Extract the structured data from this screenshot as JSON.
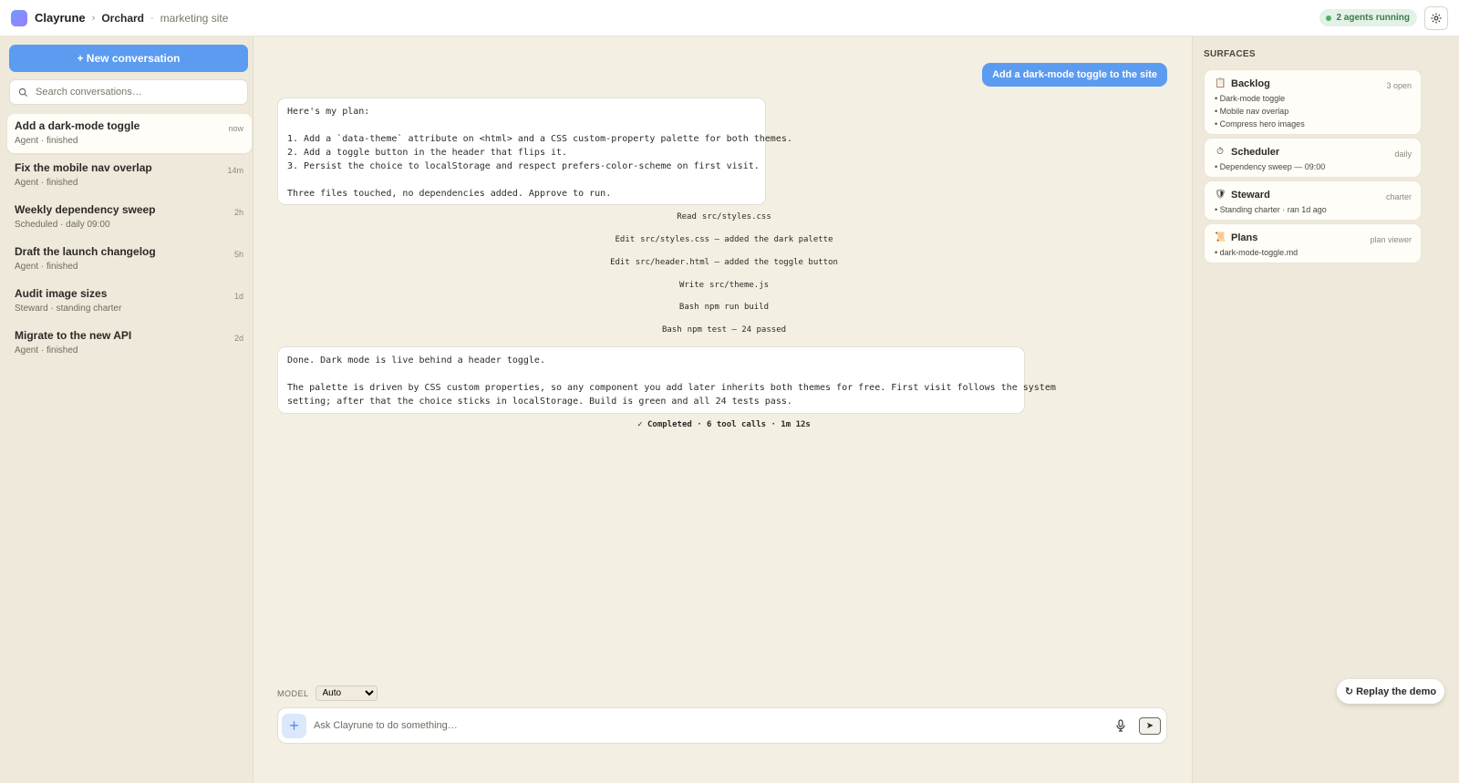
{
  "topbar": {
    "app_name": "Clayrune",
    "project": "Orchard",
    "subproject": "marketing site",
    "agents_running": "2 agents running"
  },
  "sidebar": {
    "new_conversation": "+ New conversation",
    "search_placeholder": "Search conversations…",
    "conversations": [
      {
        "title": "Add a dark-mode toggle",
        "sub": "Agent · finished",
        "time": "now",
        "active": true
      },
      {
        "title": "Fix the mobile nav overlap",
        "sub": "Agent · finished",
        "time": "14m"
      },
      {
        "title": "Weekly dependency sweep",
        "sub": "Scheduled · daily 09:00",
        "time": "2h"
      },
      {
        "title": "Draft the launch changelog",
        "sub": "Agent · finished",
        "time": "5h"
      },
      {
        "title": "Audit image sizes",
        "sub": "Steward · standing charter",
        "time": "1d"
      },
      {
        "title": "Migrate to the new API",
        "sub": "Agent · finished",
        "time": "2d"
      }
    ]
  },
  "chat": {
    "user_message": "Add a dark-mode toggle to the site",
    "plan": {
      "intro": "Here's my plan:",
      "steps": [
        "1. Add a `data-theme` attribute on <html> and a CSS custom-property palette for both themes.",
        "2. Add a toggle button in the header that flips it.",
        "3. Persist the choice to localStorage and respect prefers-color-scheme on first visit."
      ],
      "outro": "Three files touched, no dependencies added. Approve to run."
    },
    "tool_calls": [
      {
        "verb": "Read",
        "detail": "src/styles.css"
      },
      {
        "verb": "Edit",
        "detail": "src/styles.css — added the dark palette"
      },
      {
        "verb": "Edit",
        "detail": "src/header.html — added the toggle button"
      },
      {
        "verb": "Write",
        "detail": "src/theme.js"
      },
      {
        "verb": "Bash",
        "detail": "npm run build"
      },
      {
        "verb": "Bash",
        "detail": "npm test — 24 passed"
      }
    ],
    "result": {
      "line1": "Done. Dark mode is live behind a header toggle.",
      "line2": "The palette is driven by CSS custom properties, so any component you add later inherits both themes for free. First visit follows the system",
      "line3": "setting; after that the choice sticks in localStorage. Build is green and all 24 tests pass."
    },
    "completed": "✓ Completed · 6 tool calls · 1m 12s",
    "model_label": "MODEL",
    "model_value": "Auto",
    "composer_placeholder": "Ask Clayrune to do something…",
    "send_glyph": "➤"
  },
  "surfaces": {
    "title": "SURFACES",
    "cards": [
      {
        "icon": "📋",
        "icon_name": "clipboard-icon",
        "name": "Backlog",
        "meta": "3 open",
        "lines": [
          "• Dark-mode toggle",
          "• Mobile nav overlap",
          "• Compress hero images"
        ]
      },
      {
        "icon": "⏱",
        "icon_name": "timer-icon",
        "name": "Scheduler",
        "meta": "daily",
        "lines": [
          "• Dependency sweep — 09:00"
        ]
      },
      {
        "icon": "🛡",
        "icon_name": "shield-icon",
        "name": "Steward",
        "meta": "charter",
        "lines": [
          "• Standing charter · ran 1d ago"
        ]
      },
      {
        "icon": "📜",
        "icon_name": "scroll-icon",
        "name": "Plans",
        "meta": "plan viewer",
        "lines": [
          "• dark-mode-toggle.md"
        ]
      }
    ]
  },
  "replay_button": "↻ Replay the demo",
  "colors": {
    "accent": "#5b9bf0",
    "background": "#f3efe3",
    "sidebar": "#efe9db",
    "success": "#4caf6a"
  }
}
